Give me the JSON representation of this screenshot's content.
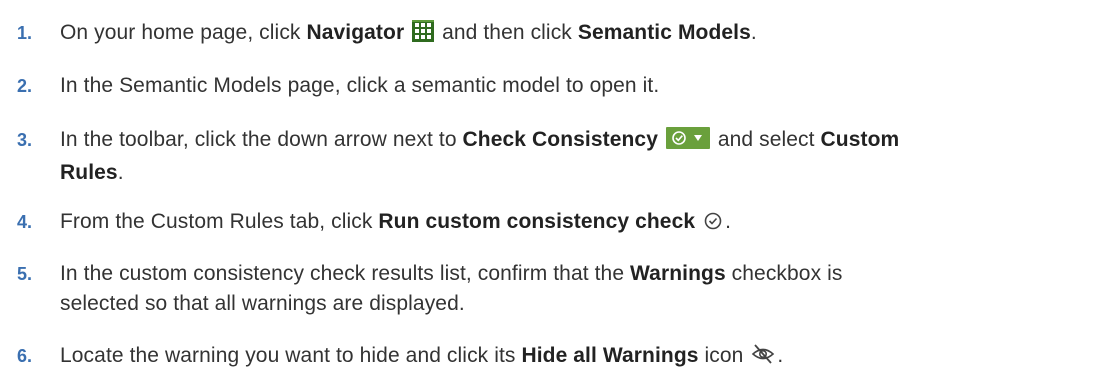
{
  "steps": [
    {
      "number": "1.",
      "parts": {
        "a": "On your home page, click ",
        "b": "Navigator",
        "c": " and then click ",
        "d": "Semantic Models",
        "e": "."
      },
      "icon": "grid-icon"
    },
    {
      "number": "2.",
      "parts": {
        "a": "In the Semantic Models page, click a semantic model to open it."
      }
    },
    {
      "number": "3.",
      "parts": {
        "a": "In the toolbar, click the down arrow next to ",
        "b": "Check Consistency",
        "c": " and select ",
        "d": "Custom",
        "e": "Rules",
        "f": "."
      },
      "icon": "check-consistency-dropdown-icon"
    },
    {
      "number": "4.",
      "parts": {
        "a": "From the Custom Rules tab, click ",
        "b": "Run custom consistency check",
        "c": "."
      },
      "icon": "check-circle-icon"
    },
    {
      "number": "5.",
      "parts": {
        "a": "In the custom consistency check results list, confirm that the ",
        "b": "Warnings",
        "c": " checkbox is",
        "d": "selected so that all warnings are displayed."
      }
    },
    {
      "number": "6.",
      "parts": {
        "a": "Locate the warning you want to hide and click its ",
        "b": "Hide all Warnings",
        "c": " icon",
        "d": "."
      },
      "icon": "hide-warnings-icon"
    }
  ],
  "colors": {
    "step_number": "#3a6fb0",
    "body_text": "#333333",
    "grid_icon": "#2f6b1f",
    "toolbar_icon_bg": "#6aa03c"
  }
}
